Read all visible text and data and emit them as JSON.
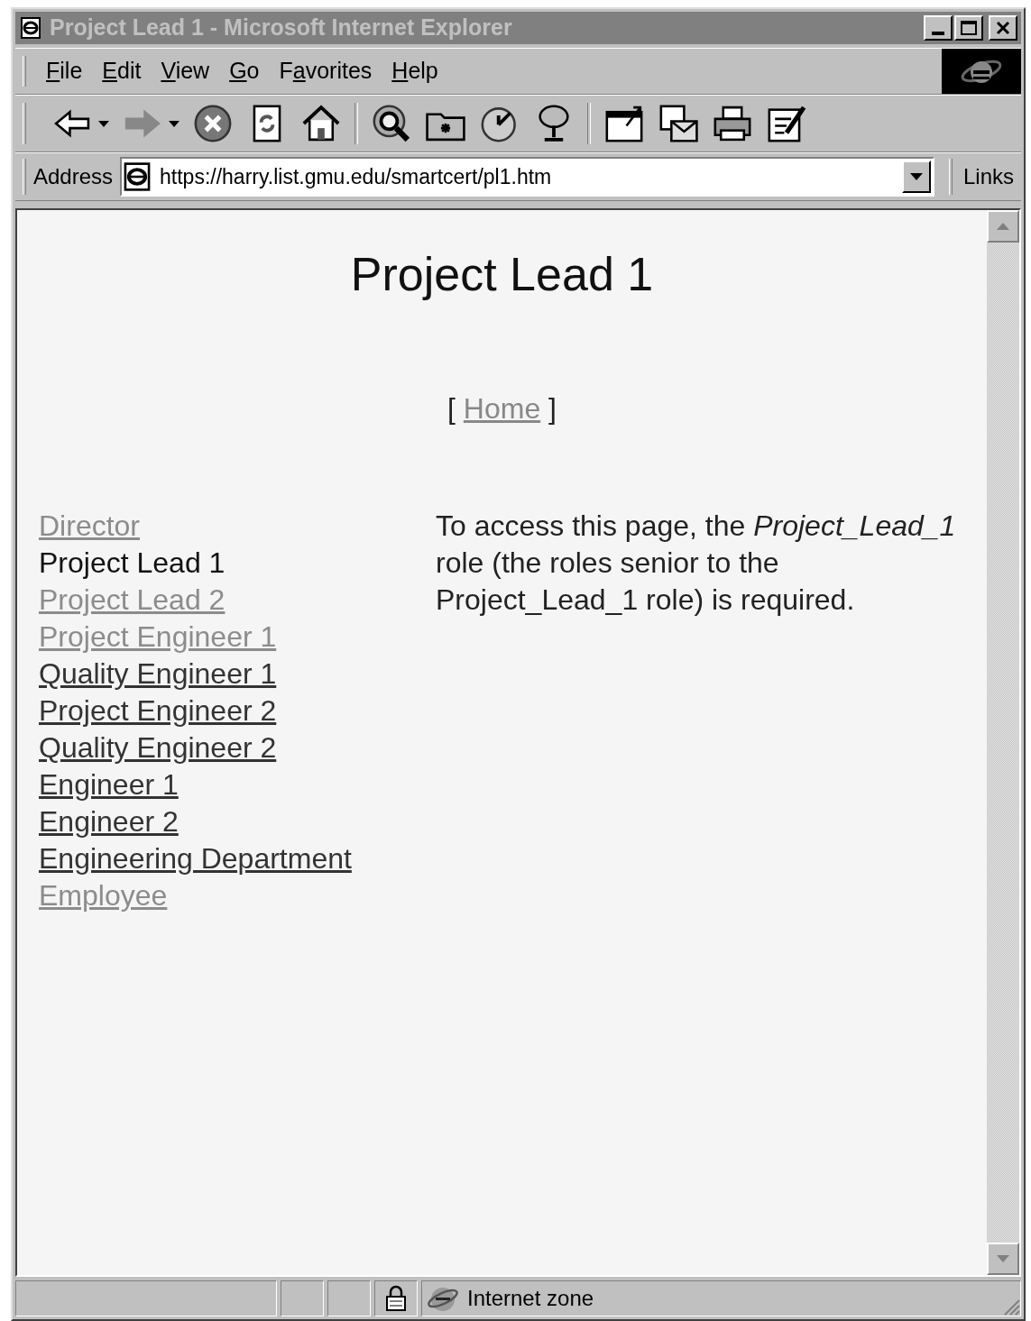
{
  "window": {
    "title": "Project Lead 1 - Microsoft Internet Explorer"
  },
  "menu": [
    {
      "key": "F",
      "post": "ile"
    },
    {
      "key": "E",
      "post": "dit"
    },
    {
      "key": "V",
      "post": "iew"
    },
    {
      "key": "G",
      "post": "o"
    },
    {
      "pre": "F",
      "key": "a",
      "post": "vorites"
    },
    {
      "key": "H",
      "post": "elp"
    }
  ],
  "address_bar": {
    "label": "Address",
    "value": "https://harry.list.gmu.edu/smartcert/pl1.htm",
    "links_label": "Links"
  },
  "page": {
    "heading": "Project Lead 1",
    "home_link": {
      "open": "[",
      "label": "Home",
      "close": "]"
    },
    "nav": [
      {
        "label": "Director",
        "kind": "link",
        "visited": true
      },
      {
        "label": "Project Lead 1",
        "kind": "current"
      },
      {
        "label": "Project Lead 2",
        "kind": "link",
        "visited": true
      },
      {
        "label": "Project Engineer 1",
        "kind": "link",
        "visited": true
      },
      {
        "label": "Quality Engineer 1",
        "kind": "link",
        "visited": false
      },
      {
        "label": "Project Engineer 2",
        "kind": "link",
        "visited": false
      },
      {
        "label": "Quality Engineer 2",
        "kind": "link",
        "visited": false
      },
      {
        "label": "Engineer 1",
        "kind": "link",
        "visited": false
      },
      {
        "label": "Engineer 2",
        "kind": "link",
        "visited": false
      },
      {
        "label": "Engineering Department",
        "kind": "link",
        "visited": false
      },
      {
        "label": "Employee",
        "kind": "link",
        "visited": true
      }
    ],
    "message": "To access this page, the *Project_Lead_1* role (the roles senior to the Project_Lead_1 role) is required."
  },
  "status_bar": {
    "zone": "Internet zone"
  }
}
